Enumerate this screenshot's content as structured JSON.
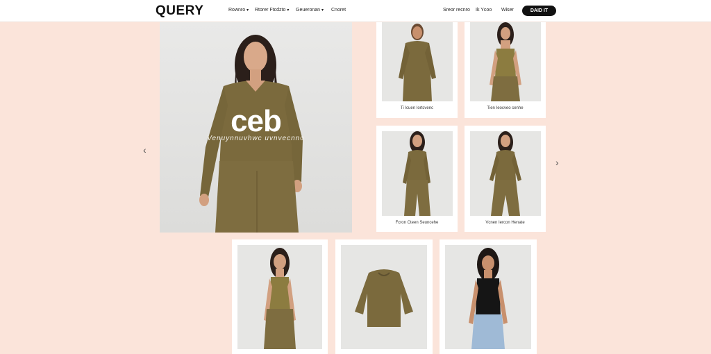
{
  "header": {
    "logo": "QUERY",
    "nav": [
      {
        "label": "Rownro",
        "chevron": "▾"
      },
      {
        "label": "Rtorer Ftcdzto",
        "chevron": "▾"
      },
      {
        "label": "Geueronan",
        "chevron": "▾"
      },
      {
        "label": "Cnoret",
        "chevron": ""
      }
    ],
    "right_links": [
      "Sreor recnro",
      "Ik Ycoo",
      "Wiser"
    ],
    "cta_label": "DAID IT"
  },
  "hero": {
    "title": "ceb",
    "subtitle": "Venuynnuvhwc uvnvecnno",
    "prev_icon": "chevron-left-icon",
    "next_icon": "chevron-right-icon"
  },
  "products": [
    {
      "caption": "Ti Icuen Iortcvenc"
    },
    {
      "caption": "Tien Ieocveo cenhe"
    },
    {
      "caption": "Fcron Cteen Seuncehe"
    },
    {
      "caption": "Vcnen Iercon Henate"
    },
    {
      "caption": ""
    },
    {
      "caption": ""
    },
    {
      "caption": ""
    }
  ],
  "colors": {
    "background": "#fbe4da",
    "olive": "#7b6a3d",
    "cta": "#111111"
  }
}
